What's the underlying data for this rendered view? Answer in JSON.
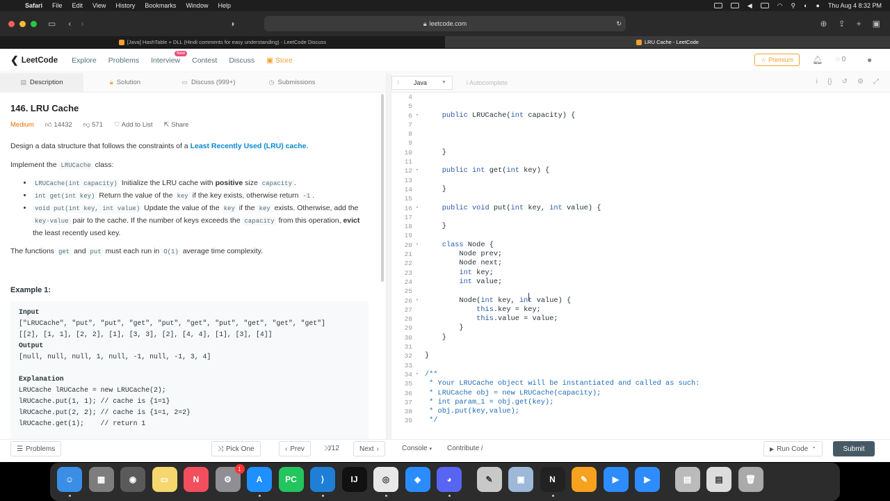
{
  "menubar": {
    "app": "Safari",
    "items": [
      "File",
      "Edit",
      "View",
      "History",
      "Bookmarks",
      "Window",
      "Help"
    ],
    "datetime": "Thu Aug 4  8:32 PM"
  },
  "browser": {
    "url": "leetcode.com",
    "tabs": [
      {
        "label": "[Java] HashTable + DLL (Hindi comments for easy understanding) - LeetCode Discuss",
        "active": false
      },
      {
        "label": "LRU Cache - LeetCode",
        "active": true
      }
    ]
  },
  "nav": {
    "logo": "LeetCode",
    "items": [
      "Explore",
      "Problems",
      "Interview",
      "Contest",
      "Discuss"
    ],
    "store": "Store",
    "new_badge": "New",
    "premium": "Premium",
    "coins": "0"
  },
  "desc_tabs": [
    "Description",
    "Solution",
    "Discuss (999+)",
    "Submissions"
  ],
  "problem": {
    "title": "146. LRU Cache",
    "difficulty": "Medium",
    "likes": "14432",
    "dislikes": "571",
    "add_to_list": "Add to List",
    "share": "Share",
    "intro_before": "Design a data structure that follows the constraints of a ",
    "intro_link": "Least Recently Used (LRU) cache",
    "intro_after": ".",
    "impl_before": "Implement the ",
    "impl_code": "LRUCache",
    "impl_after": " class:",
    "bullet1_code": "LRUCache(int capacity)",
    "bullet1_text": " Initialize the LRU cache with ",
    "bullet1_bold": "positive",
    "bullet1_text2": " size ",
    "bullet1_code2": "capacity",
    "bullet1_end": ".",
    "bullet2_code": "int get(int key)",
    "bullet2_text": " Return the value of the ",
    "bullet2_code2": "key",
    "bullet2_text2": " if the key exists, otherwise return ",
    "bullet2_code3": "-1",
    "bullet2_end": ".",
    "bullet3_code": "void put(int key, int value)",
    "bullet3_text": " Update the value of the ",
    "bullet3_code2": "key",
    "bullet3_text2": " if the ",
    "bullet3_code3": "key",
    "bullet3_text3": " exists. Otherwise, add the ",
    "bullet3_code4": "key-value",
    "bullet3_text4": " pair to the cache. If the number of keys exceeds the ",
    "bullet3_code5": "capacity",
    "bullet3_text5": " from this operation, ",
    "bullet3_bold": "evict",
    "bullet3_text6": " the least recently used key.",
    "fn_before": "The functions ",
    "fn_code1": "get",
    "fn_and": " and ",
    "fn_code2": "put",
    "fn_mid": " must each run in ",
    "fn_code3": "O(1)",
    "fn_after": " average time complexity.",
    "example_title": "Example 1:",
    "example_input_label": "Input",
    "example_input_1": "[\"LRUCache\", \"put\", \"put\", \"get\", \"put\", \"get\", \"put\", \"get\", \"get\", \"get\"]",
    "example_input_2": "[[2], [1, 1], [2, 2], [1], [3, 3], [2], [4, 4], [1], [3], [4]]",
    "example_output_label": "Output",
    "example_output": "[null, null, null, 1, null, -1, null, -1, 3, 4]",
    "example_expl_label": "Explanation",
    "example_expl": [
      "LRUCache lRUCache = new LRUCache(2);",
      "lRUCache.put(1, 1); // cache is {1=1}",
      "lRUCache.put(2, 2); // cache is {1=1, 2=2}",
      "lRUCache.get(1);    // return 1"
    ]
  },
  "editor": {
    "language": "Java",
    "autocomplete": "Autocomplete",
    "lines": [
      {
        "n": "4",
        "t": ""
      },
      {
        "n": "5",
        "t": ""
      },
      {
        "n": "6",
        "t": "    public LRUCache(int capacity) {",
        "fold": true
      },
      {
        "n": "7",
        "t": ""
      },
      {
        "n": "8",
        "t": ""
      },
      {
        "n": "9",
        "t": ""
      },
      {
        "n": "10",
        "t": "    }"
      },
      {
        "n": "11",
        "t": ""
      },
      {
        "n": "12",
        "t": "    public int get(int key) {",
        "fold": true
      },
      {
        "n": "13",
        "t": ""
      },
      {
        "n": "14",
        "t": "    }"
      },
      {
        "n": "15",
        "t": ""
      },
      {
        "n": "16",
        "t": "    public void put(int key, int value) {",
        "fold": true
      },
      {
        "n": "17",
        "t": ""
      },
      {
        "n": "18",
        "t": "    }"
      },
      {
        "n": "19",
        "t": ""
      },
      {
        "n": "20",
        "t": "    class Node {",
        "fold": true
      },
      {
        "n": "21",
        "t": "        Node prev;"
      },
      {
        "n": "22",
        "t": "        Node next;"
      },
      {
        "n": "23",
        "t": "        int key;"
      },
      {
        "n": "24",
        "t": "        int value;"
      },
      {
        "n": "25",
        "t": ""
      },
      {
        "n": "26",
        "t": "        Node(int key, int value) {",
        "fold": true
      },
      {
        "n": "27",
        "t": "            this.key = key;"
      },
      {
        "n": "28",
        "t": "            this.value = value;"
      },
      {
        "n": "29",
        "t": "        }"
      },
      {
        "n": "30",
        "t": "    }"
      },
      {
        "n": "31",
        "t": ""
      },
      {
        "n": "32",
        "t": "}"
      },
      {
        "n": "33",
        "t": ""
      },
      {
        "n": "34",
        "t": "/**",
        "fold": true,
        "comment": true
      },
      {
        "n": "35",
        "t": " * Your LRUCache object will be instantiated and called as such:",
        "comment": true
      },
      {
        "n": "36",
        "t": " * LRUCache obj = new LRUCache(capacity);",
        "comment": true
      },
      {
        "n": "37",
        "t": " * int param_1 = obj.get(key);",
        "comment": true
      },
      {
        "n": "38",
        "t": " * obj.put(key,value);",
        "comment": true
      },
      {
        "n": "39",
        "t": " */",
        "comment": true
      }
    ]
  },
  "bottom": {
    "problems": "Problems",
    "pick_one": "Pick One",
    "prev": "Prev",
    "page": "/12",
    "next": "Next",
    "console": "Console",
    "contribute": "Contribute",
    "run_code": "Run Code",
    "submit": "Submit"
  },
  "dock": [
    "Finder",
    "Launchpad",
    "Screenshot",
    "Notes",
    "News",
    "System Preferences",
    "App Store",
    "PyCharm",
    "VS Code",
    "IntelliJ",
    "Chrome",
    "Safari",
    "Discord",
    "Script Editor",
    "Preview",
    "Notion",
    "Sketch",
    "Zoom",
    "Zoom",
    "Downloads",
    "Documents",
    "Trash"
  ],
  "dock_badge": "1"
}
